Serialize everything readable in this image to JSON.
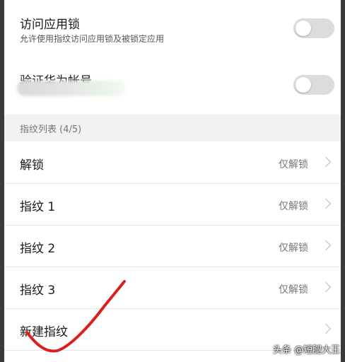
{
  "settings": {
    "app_lock": {
      "title": "访问应用锁",
      "subtitle": "允许使用指纹访问应用锁及被锁定应用",
      "enabled": false
    },
    "huawei_account": {
      "title": "验证华为帐号",
      "enabled": false
    }
  },
  "fingerprint_list": {
    "header": "指纹列表 (4/5)",
    "items": [
      {
        "label": "解锁",
        "value": "仅解锁"
      },
      {
        "label": "指纹 1",
        "value": "仅解锁"
      },
      {
        "label": "指纹 2",
        "value": "仅解锁"
      },
      {
        "label": "指纹 3",
        "value": "仅解锁"
      },
      {
        "label": "新建指纹",
        "value": ""
      }
    ]
  },
  "annotation": {
    "color": "#d92020"
  },
  "watermark": "头条 @短腿大王",
  "colors": {
    "toggle_off": "#dcdcdc",
    "section_bg": "#f2f2f2"
  }
}
